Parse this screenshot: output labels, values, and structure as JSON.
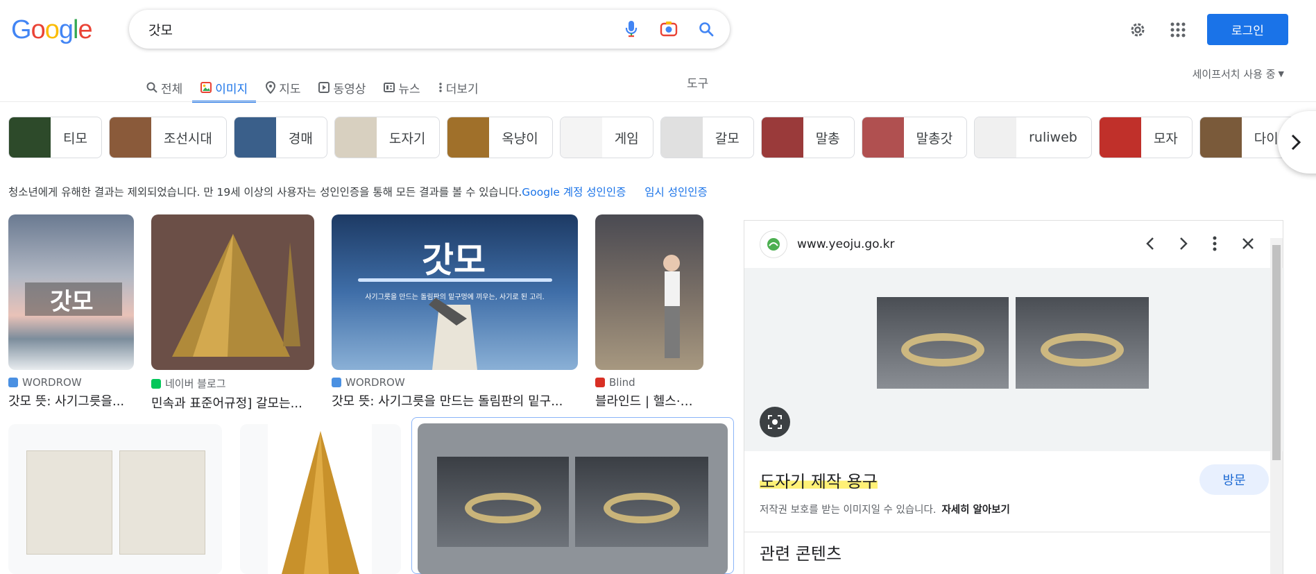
{
  "logo": {
    "letters": [
      "G",
      "o",
      "o",
      "g",
      "l",
      "e"
    ],
    "colors": [
      "#4285f4",
      "#ea4335",
      "#fbbc05",
      "#4285f4",
      "#34a853",
      "#ea4335"
    ]
  },
  "search": {
    "query": "갓모",
    "placeholder": ""
  },
  "header": {
    "login_label": "로그인"
  },
  "tabs": [
    {
      "label": "전체",
      "icon": "search-icon"
    },
    {
      "label": "이미지",
      "icon": "image-icon",
      "active": true
    },
    {
      "label": "지도",
      "icon": "map-pin-icon"
    },
    {
      "label": "동영상",
      "icon": "video-icon"
    },
    {
      "label": "뉴스",
      "icon": "news-icon"
    },
    {
      "label": "더보기",
      "icon": "more-vert-icon"
    }
  ],
  "tools_label": "도구",
  "safesearch_label": "세이프서치 사용 중",
  "chips": [
    {
      "label": "티모"
    },
    {
      "label": "조선시대"
    },
    {
      "label": "경매"
    },
    {
      "label": "도자기"
    },
    {
      "label": "옥냥이"
    },
    {
      "label": "게임"
    },
    {
      "label": "갈모"
    },
    {
      "label": "말총"
    },
    {
      "label": "말총갓"
    },
    {
      "label": "ruliweb"
    },
    {
      "label": "모자"
    },
    {
      "label": "다이어트"
    }
  ],
  "notice": {
    "text": "청소년에게 유해한 결과는 제외되었습니다. 만 19세 이상의 사용자는 성인인증을 통해 모든 결과를 볼 수 있습니다.",
    "link1": "Google 계정 성인인증",
    "link2": "임시 성인인증"
  },
  "results": [
    {
      "source": "WORDROW",
      "title": "갓모 뜻: 사기그릇을...",
      "overlay": "갓모"
    },
    {
      "source": "네이버 블로그",
      "title": "민속과 표준어규정] 갈모는..."
    },
    {
      "source": "WORDROW",
      "title": "갓모 뜻: 사기그릇을 만드는 돌림판의 밑구...",
      "overlay": "갓모",
      "subtext": "사기그릇을 만드는 돌림판의 밑구멍에 끼우는, 사기로 된 고리."
    },
    {
      "source": "Blind",
      "title": "블라인드 | 헬스·다이..."
    }
  ],
  "panel": {
    "site": "www.yeoju.go.kr",
    "title": "도자기 제작 용구",
    "visit_label": "방문",
    "copyright": "저작권 보호를 받는 이미지일 수 있습니다.",
    "learn_more": "자세히 알아보기",
    "related": "관련 콘텐츠"
  }
}
